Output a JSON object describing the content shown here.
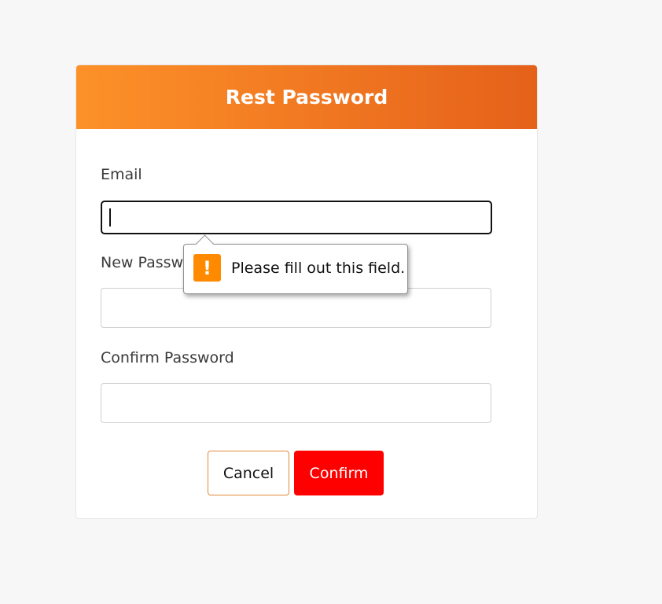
{
  "header": {
    "title": "Rest Password"
  },
  "form": {
    "email_label": "Email",
    "email_value": "",
    "new_password_label": "New Password",
    "new_password_value": "",
    "confirm_password_label": "Confirm Password",
    "confirm_password_value": ""
  },
  "buttons": {
    "cancel_label": "Cancel",
    "confirm_label": "Confirm"
  },
  "validation_tooltip": {
    "icon": "warning-exclamation-icon",
    "icon_glyph": "!",
    "message": "Please fill out this field."
  },
  "colors": {
    "header_gradient_start": "#fd9129",
    "header_gradient_end": "#e5611a",
    "confirm_button": "#ff0000",
    "warning_icon": "#ff8a00"
  }
}
